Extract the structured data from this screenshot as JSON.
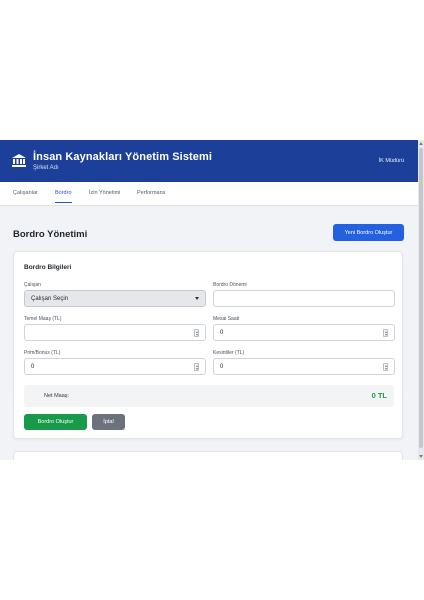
{
  "header": {
    "title": "İnsan Kaynakları Yönetim Sistemi",
    "subtitle": "Şirket Adı",
    "user": "İK Müdürü"
  },
  "tabs": [
    {
      "label": "Çalışanlar",
      "active": false
    },
    {
      "label": "Bordro",
      "active": true
    },
    {
      "label": "İzin Yönetimi",
      "active": false
    },
    {
      "label": "Performans",
      "active": false
    }
  ],
  "page": {
    "title": "Bordro Yönetimi",
    "new_button": "Yeni Bordro Oluştur"
  },
  "form": {
    "title": "Bordro Bilgileri",
    "employee_label": "Çalışan",
    "employee_value": "Çalışan Seçin",
    "period_label": "Bordro Dönemi",
    "period_value": "",
    "base_salary_label": "Temel Maaş (TL)",
    "base_salary_value": "",
    "overtime_label": "Mesai Saati",
    "overtime_value": "0",
    "bonus_label": "Prim/Bonus (TL)",
    "bonus_value": "0",
    "deductions_label": "Kesintiler (TL)",
    "deductions_value": "0",
    "net_label": "Net Maaş:",
    "net_value": "0 TL",
    "create_button": "Bordro Oluştur",
    "cancel_button": "İptal"
  },
  "colors": {
    "header": "#1c3f99",
    "primary": "#2461e0",
    "success": "#199a4a",
    "secondary": "#6b727b"
  }
}
